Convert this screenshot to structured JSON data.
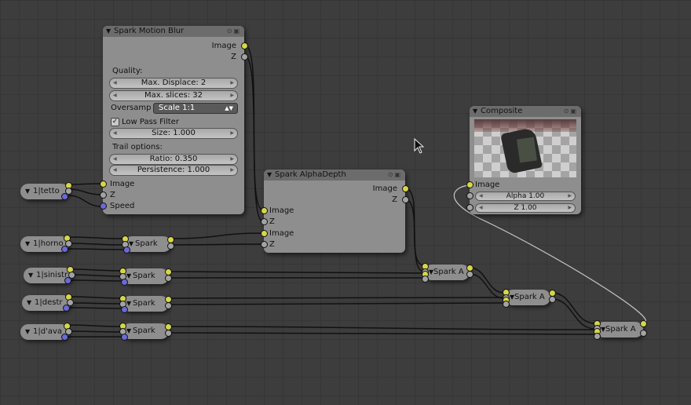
{
  "nodes": {
    "motion_blur": {
      "title": "Spark Motion Blur",
      "out_image": "Image",
      "out_z": "Z",
      "quality_label": "Quality:",
      "max_displace": "Max. Displace: 2",
      "max_slices": "Max. slices: 32",
      "oversamp_label": "Oversamp",
      "oversamp_value": "Scale 1:1",
      "low_pass_label": "Low Pass Filter",
      "low_pass_checked": true,
      "size": "Size: 1.000",
      "trail_label": "Trail options:",
      "ratio": "Ratio: 0.350",
      "persistence": "Persistence: 1.000",
      "in_image": "Image",
      "in_z": "Z",
      "in_speed": "Speed"
    },
    "alpha_depth": {
      "title": "Spark AlphaDepth",
      "out_image": "Image",
      "out_z": "Z",
      "in_image1": "Image",
      "in_z1": "Z",
      "in_image2": "Image",
      "in_z2": "Z"
    },
    "composite": {
      "title": "Composite",
      "in_image": "Image",
      "alpha": "Alpha 1.00",
      "z": "Z 1.00"
    },
    "render_layers": [
      {
        "label": "1|tetto"
      },
      {
        "label": "1|horno"
      },
      {
        "label": "1|sinistr"
      },
      {
        "label": "1|destr"
      },
      {
        "label": "1|d'ava"
      }
    ],
    "spark_nodes": [
      {
        "label": "Spark"
      },
      {
        "label": "Spark"
      },
      {
        "label": "Spark"
      },
      {
        "label": "Spark"
      }
    ],
    "spark_a_nodes": [
      {
        "label": "Spark A"
      },
      {
        "label": "Spark A"
      },
      {
        "label": "Spark A"
      }
    ]
  },
  "colors": {
    "socket_image": "#d6d64a",
    "socket_value": "#a3a3a3",
    "socket_vector": "#6a6ad6",
    "node_body": "#8e8e8e",
    "node_header": "#6c6c6c",
    "editor_background": "#3d3d3d"
  },
  "icons": {
    "collapse": "triangle-down-icon",
    "node_options": "node-options-icon",
    "cursor": "mouse-pointer-icon"
  }
}
